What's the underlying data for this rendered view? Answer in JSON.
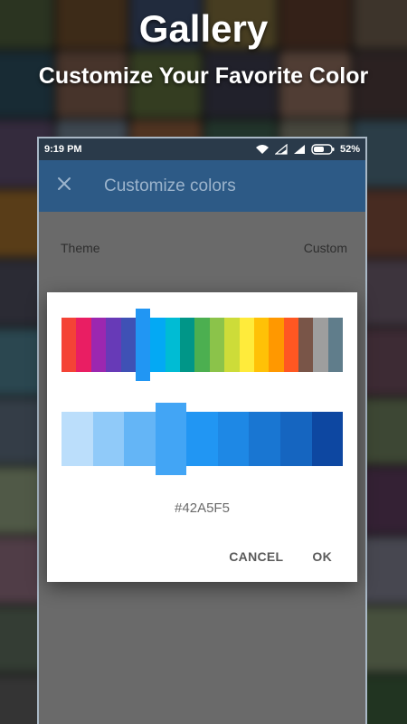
{
  "promo": {
    "title": "Gallery",
    "subtitle": "Customize Your Favorite Color"
  },
  "background_tiles": [
    "#4a5a3a",
    "#6a4a2a",
    "#3a4a6a",
    "#7a6a3a",
    "#5a3a2a",
    "#6a5a4a",
    "#2a4a5a",
    "#7a5a4a",
    "#5a6a3a",
    "#3a3a4a",
    "#8a6a5a",
    "#4a3a3a",
    "#5a4a6a",
    "#6a7a8a",
    "#8a5a3a",
    "#3a5a4a",
    "#7a7a6a",
    "#4a6a7a",
    "#9a6a2a",
    "#5a5a3a",
    "#6a3a4a",
    "#8a8a9a",
    "#3a6a5a",
    "#7a4a3a",
    "#4a4a5a",
    "#6a6a7a",
    "#5a7a4a",
    "#8a7a5a",
    "#3a4a3a",
    "#6a5a6a",
    "#4a7a8a",
    "#7a3a5a",
    "#5a5a6a",
    "#9a8a6a",
    "#3a5a6a",
    "#6a4a5a",
    "#5a6a7a",
    "#8a4a4a",
    "#4a5a5a",
    "#7a6a7a",
    "#3a3a3a",
    "#6a7a5a",
    "#8a9a7a",
    "#5a4a3a",
    "#4a6a4a",
    "#7a5a6a",
    "#6a6a5a",
    "#5a3a5a",
    "#8a6a7a",
    "#3a4a5a",
    "#9a7a4a",
    "#4a4a3a",
    "#6a5a3a",
    "#7a7a8a",
    "#5a6a5a",
    "#4a5a6a",
    "#8a5a5a",
    "#3a6a7a",
    "#6a4a4a",
    "#7a8a6a",
    "#5a5a5a",
    "#8a7a7a",
    "#4a3a5a",
    "#6a6a4a",
    "#9a8a8a",
    "#3a5a3a"
  ],
  "status_bar": {
    "time": "9:19 PM",
    "battery": "52%"
  },
  "app_bar": {
    "close_icon": "close-icon",
    "title": "Customize colors"
  },
  "settings": {
    "theme_label": "Theme",
    "theme_value": "Custom"
  },
  "dialog": {
    "primary_colors": [
      "#f44336",
      "#e91e63",
      "#9c27b0",
      "#673ab7",
      "#3f51b5",
      "#2196f3",
      "#03a9f4",
      "#00bcd4",
      "#009688",
      "#4caf50",
      "#8bc34a",
      "#cddc39",
      "#ffeb3b",
      "#ffc107",
      "#ff9800",
      "#ff5722",
      "#795548",
      "#9e9e9e",
      "#607d8b"
    ],
    "primary_selected_index": 5,
    "shades": [
      "#bbdefb",
      "#90caf9",
      "#64b5f6",
      "#42a5f5",
      "#2196f3",
      "#1e88e5",
      "#1976d2",
      "#1565c0",
      "#0d47a1"
    ],
    "shade_selected_index": 3,
    "hex_value": "#42A5F5",
    "cancel_label": "CANCEL",
    "ok_label": "OK"
  },
  "colors": {
    "app_bar": "#2d5a86",
    "status_bar": "#2a3a4a",
    "scrim": "#6a6a6a"
  }
}
